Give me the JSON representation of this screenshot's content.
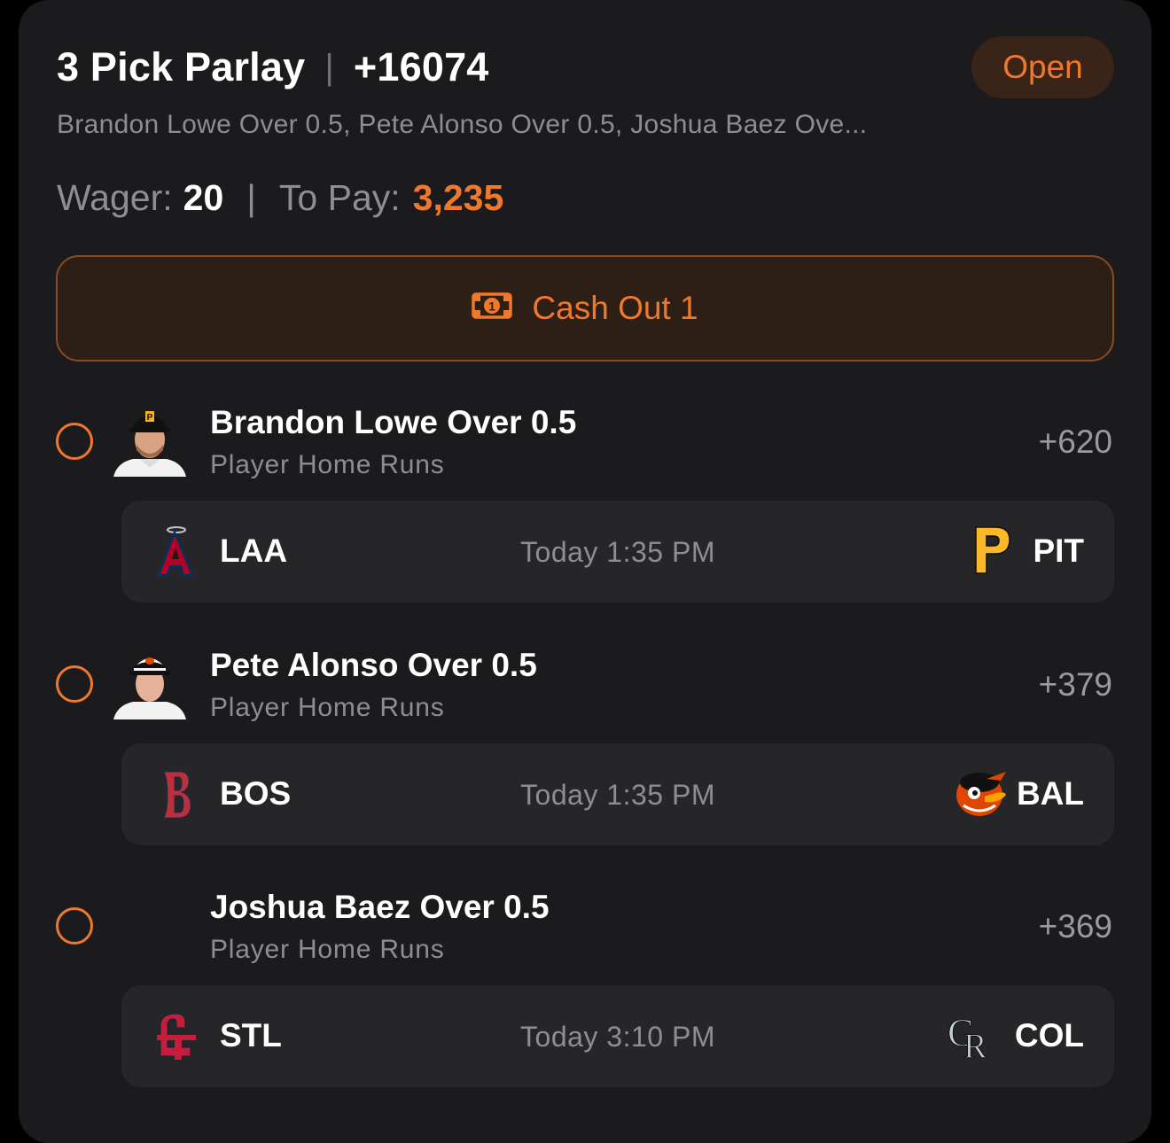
{
  "header": {
    "title": "3 Pick Parlay",
    "odds": "+16074",
    "status": "Open",
    "summary": "Brandon Lowe Over 0.5, Pete Alonso Over 0.5, Joshua Baez Ove..."
  },
  "wager": {
    "wager_label": "Wager:",
    "wager_value": "20",
    "pay_label": "To Pay:",
    "pay_value": "3,235"
  },
  "cashout": {
    "label": "Cash Out 1",
    "icon": "cash-icon"
  },
  "legs": [
    {
      "title": "Brandon Lowe Over 0.5",
      "market": "Player Home Runs",
      "odds": "+620",
      "avatar": "player-photo",
      "game": {
        "away": "LAA",
        "home": "PIT",
        "time": "Today 1:35 PM",
        "away_logo": "angels-logo",
        "home_logo": "pirates-logo"
      }
    },
    {
      "title": "Pete Alonso Over 0.5",
      "market": "Player Home Runs",
      "odds": "+379",
      "avatar": "player-photo",
      "game": {
        "away": "BOS",
        "home": "BAL",
        "time": "Today 1:35 PM",
        "away_logo": "red-sox-logo",
        "home_logo": "orioles-logo"
      }
    },
    {
      "title": "Joshua Baez Over 0.5",
      "market": "Player Home Runs",
      "odds": "+369",
      "avatar": "",
      "game": {
        "away": "STL",
        "home": "COL",
        "time": "Today 3:10 PM",
        "away_logo": "cardinals-logo",
        "home_logo": "rockies-logo"
      }
    }
  ],
  "colors": {
    "accent": "#f0782c",
    "card": "#1b1b1d",
    "muted": "#8d8d95",
    "game_box": "#262628"
  }
}
